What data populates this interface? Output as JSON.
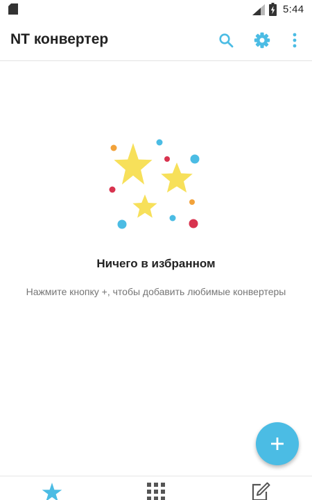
{
  "status_bar": {
    "time": "5:44",
    "icons": [
      "sd-card-icon",
      "signal-icon",
      "battery-charging-icon"
    ]
  },
  "app_bar": {
    "title": "NT конвертер",
    "actions": [
      "search-icon",
      "settings-gear-icon",
      "more-vert-icon"
    ]
  },
  "empty_state": {
    "title": "Ничего в избранном",
    "hint": "Нажмите кнопку +, чтобы добавить любимые конвертеры",
    "illustration": "stars-and-dots-illustration"
  },
  "fab": {
    "icon": "plus-icon"
  },
  "bottom_nav": {
    "items": [
      {
        "icon": "star-icon",
        "selected": true
      },
      {
        "icon": "grid-icon",
        "selected": false
      },
      {
        "icon": "edit-icon",
        "selected": false
      }
    ]
  },
  "colors": {
    "accent": "#4bbce4",
    "star": "#f7e05a",
    "dot_red": "#d8334f",
    "dot_orange": "#f2a23a",
    "dot_blue": "#4bbce4"
  }
}
